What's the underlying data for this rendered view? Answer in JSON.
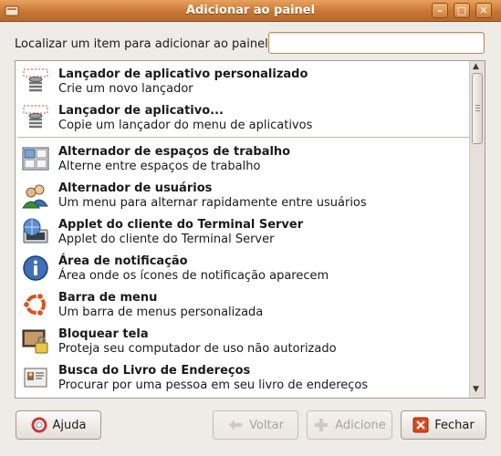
{
  "window": {
    "title": "Adicionar ao painel"
  },
  "search": {
    "label": "Localizar um item para adicionar ao painel:",
    "value": "",
    "placeholder": ""
  },
  "items": [
    {
      "name": "Lançador de aplicativo personalizado",
      "desc": "Crie um novo lançador"
    },
    {
      "name": "Lançador de aplicativo...",
      "desc": "Copie um lançador do menu de aplicativos"
    },
    {
      "name": "Alternador de espaços de trabalho",
      "desc": "Alterne entre espaços de trabalho"
    },
    {
      "name": "Alternador de usuários",
      "desc": "Um menu para alternar rapidamente entre usuários"
    },
    {
      "name": "Applet do cliente do Terminal Server",
      "desc": "Applet do cliente do Terminal Server"
    },
    {
      "name": "Área de notificação",
      "desc": "Área onde os ícones de notificação aparecem"
    },
    {
      "name": "Barra de menu",
      "desc": "Um barra de menus personalizada"
    },
    {
      "name": "Bloquear tela",
      "desc": "Proteja seu computador de uso não autorizado"
    },
    {
      "name": "Busca do Livro de Endereços",
      "desc": "Procurar por uma pessoa em seu livro de endereços"
    }
  ],
  "buttons": {
    "help": "Ajuda",
    "back": "Voltar",
    "add": "Adicione",
    "close": "Fechar"
  }
}
